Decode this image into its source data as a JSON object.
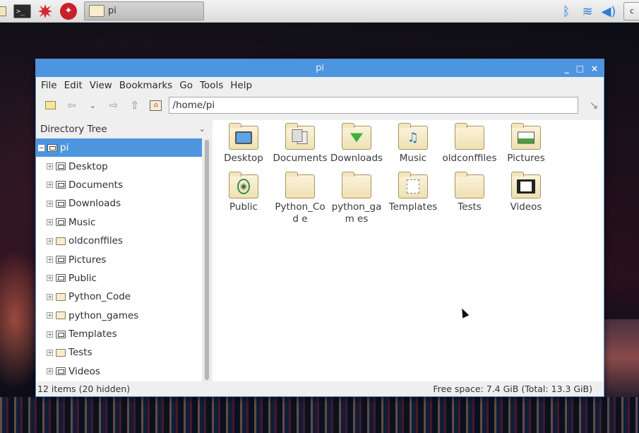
{
  "taskbar": {
    "launchers": [
      {
        "name": "file-manager-launcher",
        "icon": "folder-icon"
      },
      {
        "name": "terminal-launcher",
        "icon": "terminal-icon",
        "glyph": ">_"
      },
      {
        "name": "wolfram-launcher",
        "icon": "starburst-icon"
      },
      {
        "name": "mathematica-launcher",
        "icon": "mathematica-icon"
      }
    ],
    "task_button_label": "pi",
    "tray": {
      "bluetooth": "bluetooth-icon",
      "wifi": "wifi-icon",
      "volume": "volume-icon"
    }
  },
  "window": {
    "title": "pi",
    "controls": {
      "minimize": "_",
      "maximize": "□",
      "close": "×"
    },
    "menu": [
      "File",
      "Edit",
      "View",
      "Bookmarks",
      "Go",
      "Tools",
      "Help"
    ],
    "address": "/home/pi",
    "sidepane": {
      "mode_label": "Directory Tree",
      "root": "pi",
      "items": [
        {
          "label": "Desktop",
          "icon": "desktop-folder-icon"
        },
        {
          "label": "Documents",
          "icon": "documents-folder-icon"
        },
        {
          "label": "Downloads",
          "icon": "downloads-folder-icon"
        },
        {
          "label": "Music",
          "icon": "music-folder-icon"
        },
        {
          "label": "oldconffiles",
          "icon": "folder-icon"
        },
        {
          "label": "Pictures",
          "icon": "pictures-folder-icon"
        },
        {
          "label": "Public",
          "icon": "public-folder-icon"
        },
        {
          "label": "Python_Code",
          "icon": "folder-icon"
        },
        {
          "label": "python_games",
          "icon": "folder-icon"
        },
        {
          "label": "Templates",
          "icon": "templates-folder-icon"
        },
        {
          "label": "Tests",
          "icon": "folder-icon"
        },
        {
          "label": "Videos",
          "icon": "videos-folder-icon"
        }
      ]
    },
    "files": [
      {
        "label": "Desktop",
        "icon": "desktop-folder-icon"
      },
      {
        "label": "Documents",
        "icon": "documents-folder-icon"
      },
      {
        "label": "Downloads",
        "icon": "downloads-folder-icon"
      },
      {
        "label": "Music",
        "icon": "music-folder-icon"
      },
      {
        "label": "oldconffiles",
        "icon": "folder-icon"
      },
      {
        "label": "Pictures",
        "icon": "pictures-folder-icon"
      },
      {
        "label": "Public",
        "icon": "public-folder-icon"
      },
      {
        "label": "Python_Cod e",
        "icon": "folder-icon"
      },
      {
        "label": "python_gam es",
        "icon": "folder-icon"
      },
      {
        "label": "Templates",
        "icon": "templates-folder-icon"
      },
      {
        "label": "Tests",
        "icon": "folder-icon"
      },
      {
        "label": "Videos",
        "icon": "videos-folder-icon"
      }
    ],
    "status_left": "12 items (20 hidden)",
    "status_right": "Free space: 7.4 GiB (Total: 13.3 GiB)"
  },
  "colors": {
    "titlebar": "#4d95df",
    "selection": "#4d95df",
    "accent": "#2a7fd4"
  }
}
